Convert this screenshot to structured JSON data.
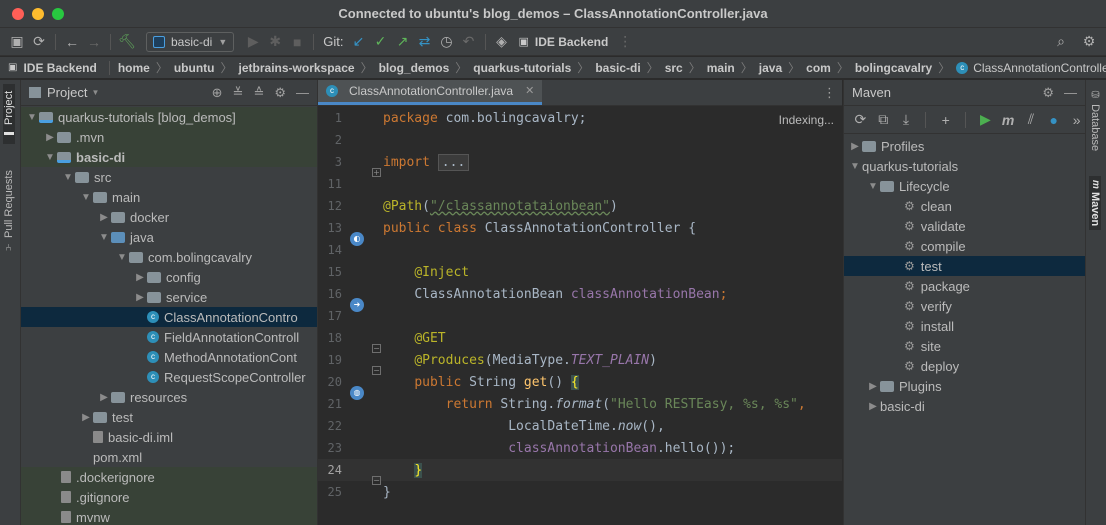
{
  "window": {
    "title": "Connected to ubuntu's blog_demos – ClassAnnotationController.java"
  },
  "toolbar": {
    "run_config": "basic-di",
    "git_label": "Git:",
    "ide_backend": "IDE Backend"
  },
  "navbar": {
    "backend": "IDE Backend",
    "breadcrumbs": [
      "home",
      "ubuntu",
      "jetbrains-workspace",
      "blog_demos",
      "quarkus-tutorials",
      "basic-di",
      "src",
      "main",
      "java",
      "com",
      "bolingcavalry",
      "ClassAnnotationController.j"
    ]
  },
  "left_strip": {
    "project_tab": "Project",
    "pull_requests_tab": "Pull Requests"
  },
  "right_strip": {
    "database_tab": "Database",
    "maven_tab": "Maven"
  },
  "project": {
    "title": "Project",
    "tree": [
      {
        "label": "quarkus-tutorials",
        "suffix": "[blog_demos]"
      },
      {
        "label": ".mvn"
      },
      {
        "label": "basic-di"
      },
      {
        "label": "src"
      },
      {
        "label": "main"
      },
      {
        "label": "docker"
      },
      {
        "label": "java"
      },
      {
        "label": "com.bolingcavalry"
      },
      {
        "label": "config"
      },
      {
        "label": "service"
      },
      {
        "label": "ClassAnnotationContro"
      },
      {
        "label": "FieldAnnotationControll"
      },
      {
        "label": "MethodAnnotationCont"
      },
      {
        "label": "RequestScopeController"
      },
      {
        "label": "resources"
      },
      {
        "label": "test"
      },
      {
        "label": "basic-di.iml"
      },
      {
        "label": "pom.xml"
      },
      {
        "label": ".dockerignore"
      },
      {
        "label": ".gitignore"
      },
      {
        "label": "mvnw"
      }
    ]
  },
  "editor": {
    "tab_label": "ClassAnnotationController.java",
    "status": "Indexing...",
    "line_numbers": [
      "1",
      "2",
      "3",
      "11",
      "12",
      "13",
      "14",
      "15",
      "16",
      "17",
      "18",
      "19",
      "20",
      "21",
      "22",
      "23",
      "24",
      "25"
    ],
    "code": {
      "l1_kw": "package",
      "l1_rest": " com.bolingcavalry;",
      "l3_kw": "import",
      "l3_fold": "...",
      "l12_ann": "@Path",
      "l12_open": "(",
      "l12_str": "\"/classannotataionbean\"",
      "l12_close": ")",
      "l13_kw": "public class",
      "l13_rest": " ClassAnnotationController {",
      "l15_ann": "@Inject",
      "l16_type": "ClassAnnotationBean ",
      "l16_field": "classAnnotationBean",
      "l16_semi": ";",
      "l18_ann": "@GET",
      "l19_ann": "@Produces",
      "l19_open": "(MediaType.",
      "l19_const": "TEXT_PLAIN",
      "l19_close": ")",
      "l20_kw": "public",
      "l20_type": " String ",
      "l20_fn": "get",
      "l20_rest": "() ",
      "l20_brace": "{",
      "l21_kw": "return",
      "l21_type": " String.",
      "l21_fn": "format",
      "l21_open": "(",
      "l21_str": "\"Hello RESTEasy, %s, %s\"",
      "l21_comma": ",",
      "l22_type": "LocalDateTime.",
      "l22_fn": "now",
      "l22_rest": "(),",
      "l23_field": "classAnnotationBean",
      "l23_rest": ".hello());",
      "l24_brace": "}",
      "l25_brace": "}"
    }
  },
  "maven": {
    "title": "Maven",
    "tree": [
      {
        "label": "Profiles"
      },
      {
        "label": "quarkus-tutorials"
      },
      {
        "label": "Lifecycle"
      },
      {
        "label": "clean"
      },
      {
        "label": "validate"
      },
      {
        "label": "compile"
      },
      {
        "label": "test"
      },
      {
        "label": "package"
      },
      {
        "label": "verify"
      },
      {
        "label": "install"
      },
      {
        "label": "site"
      },
      {
        "label": "deploy"
      },
      {
        "label": "Plugins"
      },
      {
        "label": "basic-di"
      }
    ]
  }
}
